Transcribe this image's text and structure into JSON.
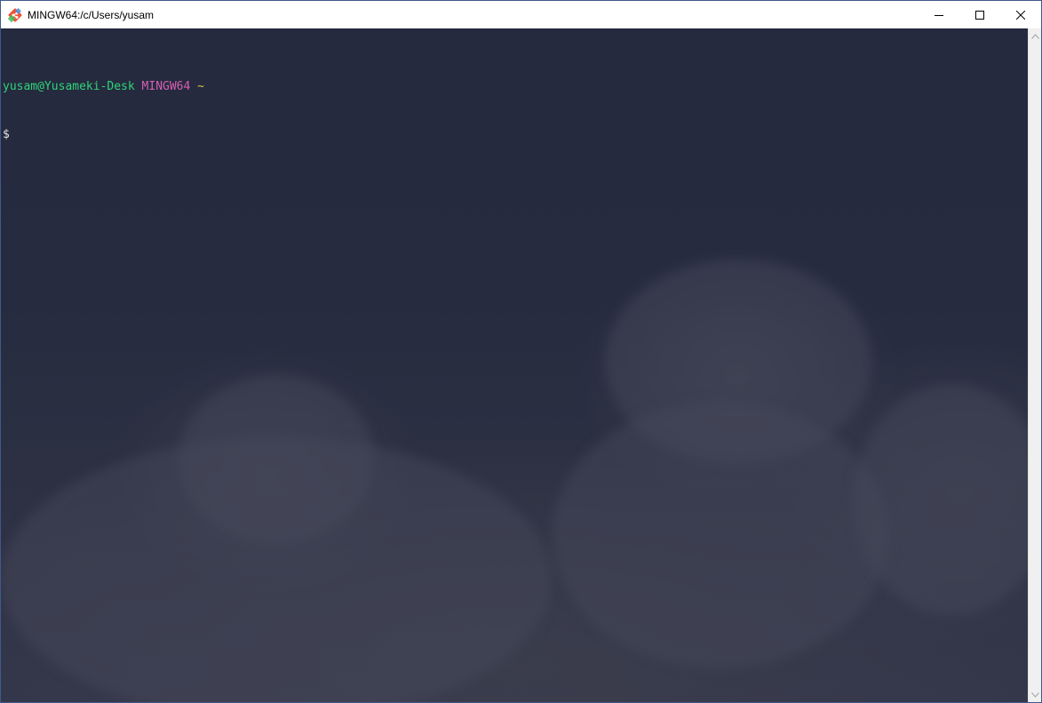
{
  "window": {
    "title": "MINGW64:/c/Users/yusam",
    "app_icon": "git-bash-icon",
    "controls": {
      "minimize": "minimize-icon",
      "maximize": "maximize-icon",
      "close": "close-icon"
    }
  },
  "terminal": {
    "prompt": {
      "user_host": "yusam@Yusameki-Desk",
      "system": "MINGW64",
      "path": "~",
      "symbol": "$"
    },
    "colors": {
      "user_host": "#2fd37a",
      "system": "#d65fb3",
      "path": "#d8c44a",
      "background": "#252a3d"
    }
  },
  "scrollbar": {
    "up_icon": "chevron-up-icon",
    "down_icon": "chevron-down-icon"
  }
}
